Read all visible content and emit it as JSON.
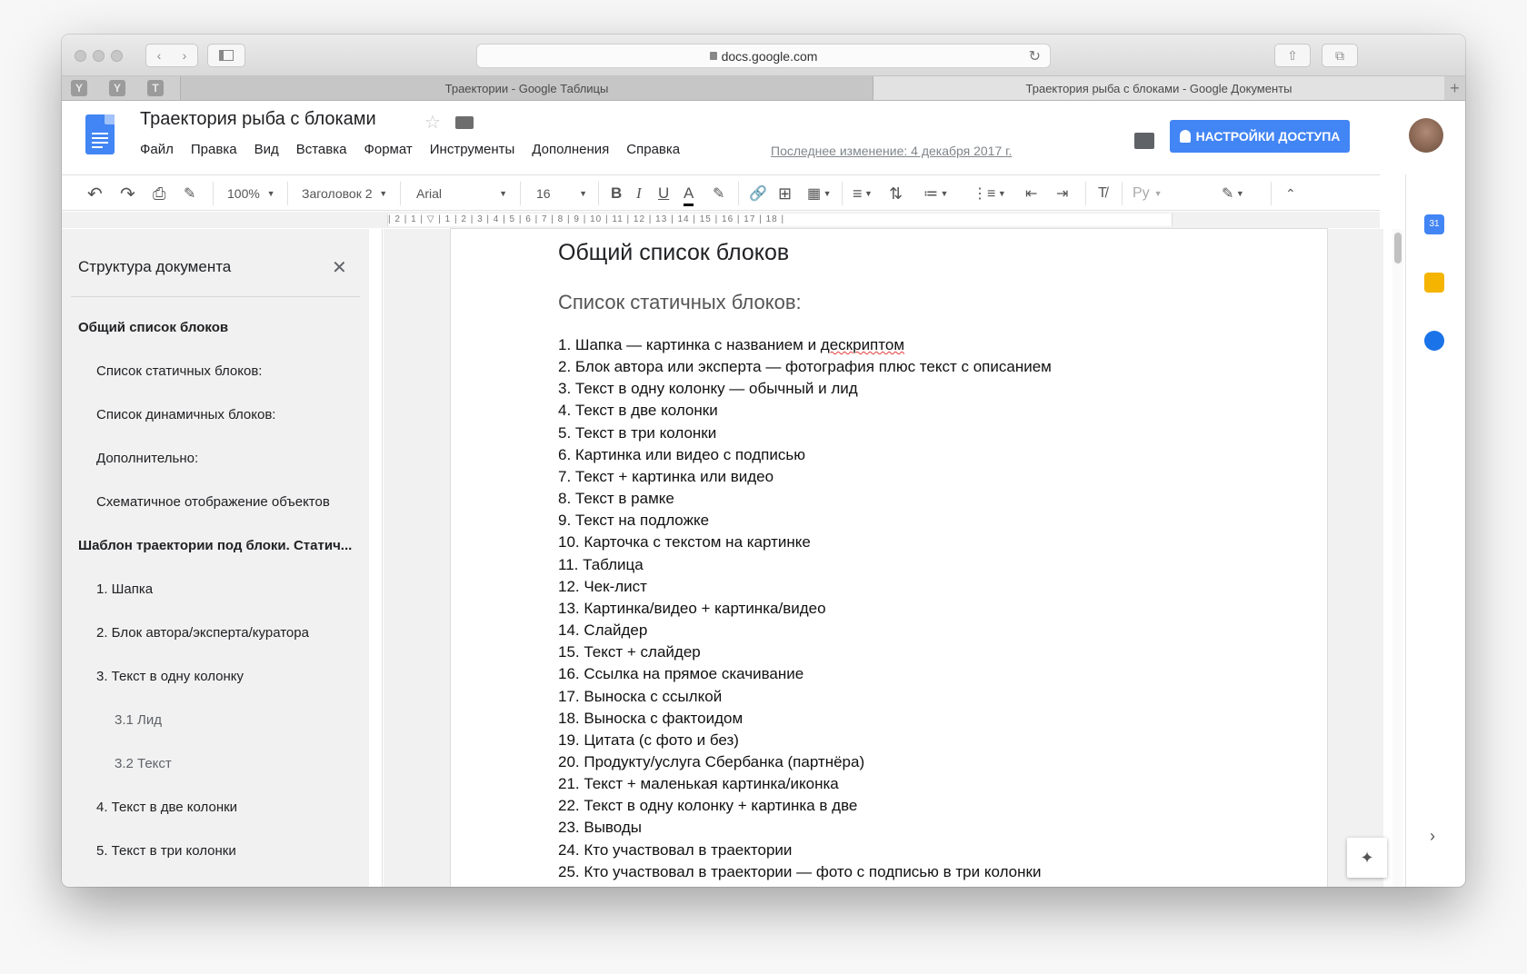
{
  "browser": {
    "url": "docs.google.com",
    "tabs": [
      {
        "title": "Траектории - Google Таблицы"
      },
      {
        "title": "Траектория рыба с блоками - Google Документы"
      }
    ],
    "pinned_tabs": [
      "Y",
      "Y",
      "T"
    ]
  },
  "doc": {
    "title": "Траектория рыба с блоками",
    "last_edit": "Последнее изменение: 4 декабря 2017 г.",
    "share_label": "НАСТРОЙКИ ДОСТУПА"
  },
  "menu": [
    "Файл",
    "Правка",
    "Вид",
    "Вставка",
    "Формат",
    "Инструменты",
    "Дополнения",
    "Справка"
  ],
  "toolbar": {
    "zoom": "100%",
    "style": "Заголовок 2",
    "font": "Arial",
    "size": "16",
    "lang": "Ру"
  },
  "ruler": {
    "text": "| 2 | 1 | ▽ | 1 | 2 | 3 | 4 | 5 | 6 | 7 | 8 | 9 | 10 | 11 | 12 | 13 | 14 | 15 | 16 | 17 | 18 |"
  },
  "outline": {
    "title": "Структура документа",
    "items": [
      {
        "label": "Общий список блоков"
      },
      {
        "label": "Список статичных блоков:"
      },
      {
        "label": "Список динамичных блоков:"
      },
      {
        "label": "Дополнительно:"
      },
      {
        "label": "Схематичное отображение объектов"
      },
      {
        "label": "Шаблон траектории под блоки. Статич..."
      },
      {
        "label": "1. Шапка"
      },
      {
        "label": "2. Блок автора/эксперта/куратора"
      },
      {
        "label": "3. Текст в одну колонку"
      },
      {
        "label": "3.1 Лид"
      },
      {
        "label": "3.2 Текст"
      },
      {
        "label": "4. Текст в две колонки"
      },
      {
        "label": "5. Текст в три колонки"
      }
    ]
  },
  "content": {
    "h1": "Общий список блоков",
    "h2": "Список статичных блоков:",
    "item1_pre": "1. Шапка — картинка с названием и ",
    "item1_word": "дескриптом",
    "items": [
      "2. Блок автора или эксперта — фотография плюс текст с описанием",
      "3. Текст в одну колонку — обычный и лид",
      "4. Текст в две колонки",
      "5. Текст в три колонки",
      "6. Картинка или видео с подписью",
      "7. Текст + картинка или видео",
      "8. Текст в рамке",
      "9. Текст на подложке",
      "10. Карточка с текстом на картинке",
      "11. Таблица",
      "12. Чек-лист",
      "13. Картинка/видео + картинка/видео",
      "14. Слайдер",
      "15. Текст + слайдер",
      "16. Ссылка на прямое скачивание",
      "17. Выноска с ссылкой",
      "18. Выноска с фактоидом",
      "19. Цитата (с фото и без)",
      "20. Продукту/услуга Сбербанка (партнёра)",
      "21. Текст + маленькая картинка/иконка",
      "22. Текст в одну колонку + картинка в две",
      "23. Выводы",
      "24. Кто участвовал в траектории",
      "25. Кто участвовал в траектории — фото с подписью в три колонки"
    ]
  },
  "side_panel": {
    "calendar_label": "31"
  },
  "colors": {
    "accent": "#4285f4",
    "keep": "#f4b400",
    "tasks": "#1a73e8"
  }
}
